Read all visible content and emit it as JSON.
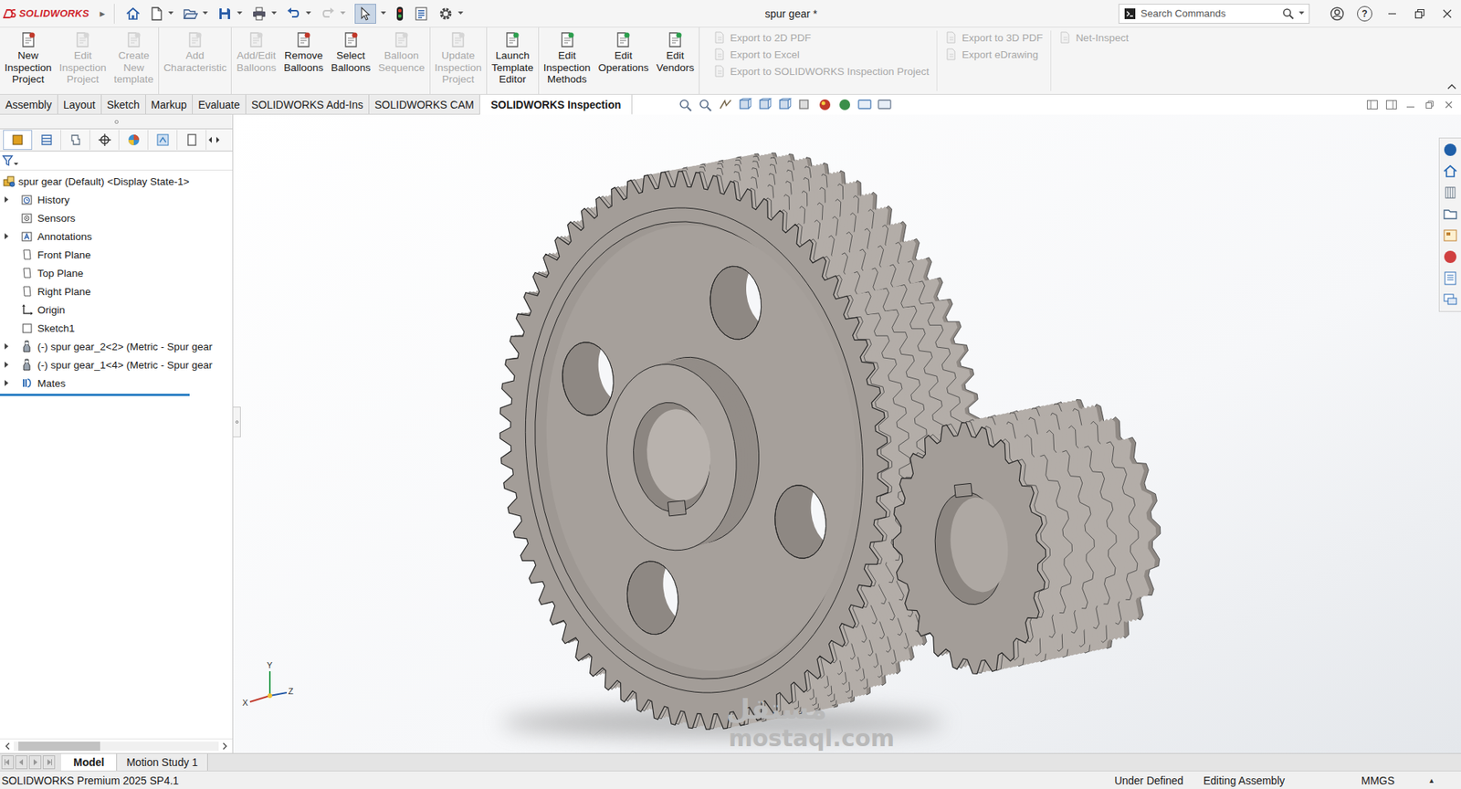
{
  "app": {
    "logo": "SOLIDWORKS",
    "menu_arrow": "▶"
  },
  "window": {
    "title": "spur gear *"
  },
  "quick_access": {
    "select_active": true,
    "redo_disabled": true
  },
  "search": {
    "placeholder": "Search Commands"
  },
  "help": "?",
  "ribbon": {
    "groups": [
      [
        {
          "label": "New Inspection Project",
          "disabled": false
        },
        {
          "label": "Edit Inspection Project",
          "disabled": true
        },
        {
          "label": "Create New template",
          "disabled": true
        }
      ],
      [
        {
          "label": "Add Characteristic",
          "disabled": true
        }
      ],
      [
        {
          "label": "Add/Edit Balloons",
          "disabled": true
        },
        {
          "label": "Remove Balloons",
          "disabled": false
        },
        {
          "label": "Select Balloons",
          "disabled": false
        },
        {
          "label": "Balloon Sequence",
          "disabled": true
        }
      ],
      [
        {
          "label": "Update Inspection Project",
          "disabled": true
        }
      ],
      [
        {
          "label": "Launch Template Editor",
          "disabled": false
        }
      ],
      [
        {
          "label": "Edit Inspection Methods",
          "disabled": false
        },
        {
          "label": "Edit Operations",
          "disabled": false
        },
        {
          "label": "Edit Vendors",
          "disabled": false
        }
      ]
    ],
    "export_columns": [
      [
        {
          "label": "Export to 2D PDF",
          "disabled": true
        },
        {
          "label": "Export to Excel",
          "disabled": true
        },
        {
          "label": "Export to SOLIDWORKS Inspection Project",
          "disabled": true
        }
      ],
      [
        {
          "label": "Export to 3D PDF",
          "disabled": true
        },
        {
          "label": "Export eDrawing",
          "disabled": true
        }
      ],
      [
        {
          "label": "Net-Inspect",
          "disabled": true
        }
      ]
    ]
  },
  "tabs": [
    {
      "label": "Assembly",
      "selected": false
    },
    {
      "label": "Layout",
      "selected": false
    },
    {
      "label": "Sketch",
      "selected": false
    },
    {
      "label": "Markup",
      "selected": false
    },
    {
      "label": "Evaluate",
      "selected": false
    },
    {
      "label": "SOLIDWORKS Add-Ins",
      "selected": false
    },
    {
      "label": "SOLIDWORKS CAM",
      "selected": false
    },
    {
      "label": "SOLIDWORKS Inspection",
      "selected": true
    }
  ],
  "panel_tabs": [
    {
      "selected": true
    },
    {
      "selected": false
    },
    {
      "selected": false
    },
    {
      "selected": false
    },
    {
      "selected": false
    },
    {
      "selected": false
    },
    {
      "selected": false
    }
  ],
  "tree": {
    "root": {
      "label": "spur gear (Default) <Display State-1>",
      "kind": "assembly"
    },
    "items": [
      {
        "label": "History",
        "kind": "history",
        "toggle": true,
        "expanded": false
      },
      {
        "label": "Sensors",
        "kind": "sensors",
        "toggle": false,
        "expanded": false
      },
      {
        "label": "Annotations",
        "kind": "annotations",
        "toggle": true,
        "expanded": false
      },
      {
        "label": "Front Plane",
        "kind": "plane",
        "toggle": false,
        "expanded": false
      },
      {
        "label": "Top Plane",
        "kind": "plane",
        "toggle": false,
        "expanded": false
      },
      {
        "label": "Right Plane",
        "kind": "plane",
        "toggle": false,
        "expanded": false
      },
      {
        "label": "Origin",
        "kind": "origin",
        "toggle": false,
        "expanded": false
      },
      {
        "label": "Sketch1",
        "kind": "sketch",
        "toggle": false,
        "expanded": false
      },
      {
        "label": "(-) spur gear_2<2> (Metric - Spur gear",
        "kind": "part",
        "toggle": true,
        "expanded": false
      },
      {
        "label": "(-) spur gear_1<4> (Metric - Spur gear",
        "kind": "part",
        "toggle": true,
        "expanded": false
      },
      {
        "label": "Mates",
        "kind": "mates",
        "toggle": true,
        "expanded": false
      }
    ],
    "scroll_level": 0.4
  },
  "graphics": {
    "triad": {
      "x": "X",
      "y": "Y",
      "z": "Z"
    },
    "watermark": {
      "arabic": "مستقل",
      "latin": "mostaql.com"
    }
  },
  "bottom_tabs": [
    {
      "label": "Model",
      "selected": true
    },
    {
      "label": "Motion Study 1",
      "selected": false
    }
  ],
  "status_bar": {
    "product": "SOLIDWORKS Premium 2025 SP4.1",
    "state": "Under Defined",
    "mode": "Editing Assembly",
    "units": "MMGS",
    "arrow": "▲"
  }
}
